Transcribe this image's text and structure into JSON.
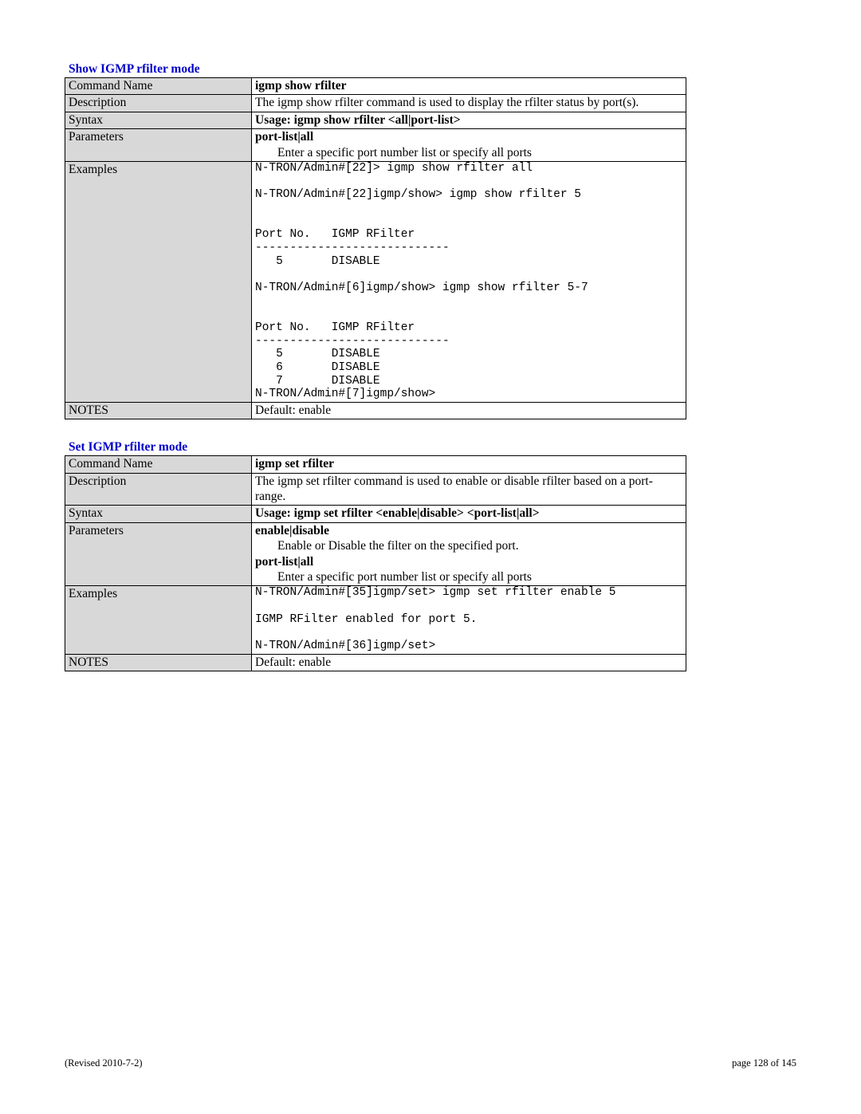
{
  "section1": {
    "title": "Show IGMP rfilter mode",
    "command_name_label": "Command Name",
    "command_name_value": "igmp show rfilter",
    "description_label": "Description",
    "description_value": "The igmp show rfilter command is used to display the rfilter status by port(s).",
    "syntax_label": "Syntax",
    "syntax_value": "Usage: igmp show rfilter <all|port-list>",
    "parameters_label": "Parameters",
    "param_head": "port-list|all",
    "param_text": "Enter a specific port number list or specify all ports",
    "examples_label": "Examples",
    "examples_text": "N-TRON/Admin#[22]> igmp show rfilter all\n\nN-TRON/Admin#[22]igmp/show> igmp show rfilter 5\n\n\nPort No.   IGMP RFilter\n----------------------------\n   5       DISABLE\n\nN-TRON/Admin#[6]igmp/show> igmp show rfilter 5-7\n\n\nPort No.   IGMP RFilter\n----------------------------\n   5       DISABLE\n   6       DISABLE\n   7       DISABLE\nN-TRON/Admin#[7]igmp/show>",
    "notes_label": "NOTES",
    "notes_value": "Default: enable"
  },
  "section2": {
    "title": "Set IGMP rfilter mode",
    "command_name_label": "Command Name",
    "command_name_value": "igmp set rfilter",
    "description_label": "Description",
    "description_value": "The igmp set rfilter command is used to enable or disable rfilter based on a port-range.",
    "syntax_label": "Syntax",
    "syntax_value": "Usage: igmp set rfilter <enable|disable> <port-list|all>",
    "parameters_label": "Parameters",
    "param1_head": "enable|disable",
    "param1_text": "Enable or Disable the filter on the specified port.",
    "param2_head": "port-list|all",
    "param2_text": "Enter a specific port number list or specify all ports",
    "examples_label": "Examples",
    "examples_text": "N-TRON/Admin#[35]igmp/set> igmp set rfilter enable 5\n\nIGMP RFilter enabled for port 5.\n\nN-TRON/Admin#[36]igmp/set>",
    "notes_label": "NOTES",
    "notes_value": "Default: enable"
  },
  "footer": {
    "left": "(Revised 2010-7-2)",
    "right": "page 128 of 145"
  }
}
